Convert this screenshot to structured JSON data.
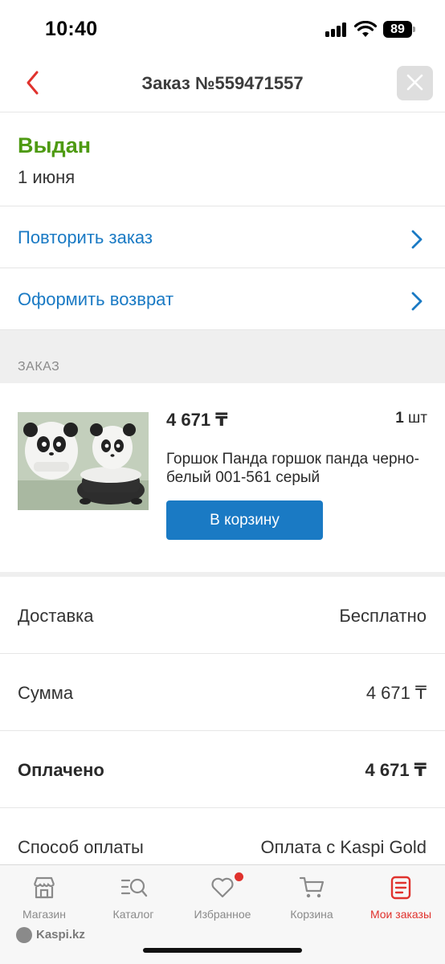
{
  "status_bar": {
    "time": "10:40",
    "battery": "89"
  },
  "header": {
    "title": "Заказ №559471557"
  },
  "order_status": {
    "title": "Выдан",
    "date": "1 июня"
  },
  "actions": [
    {
      "label": "Повторить заказ"
    },
    {
      "label": "Оформить возврат"
    }
  ],
  "section": {
    "label": "ЗАКАЗ"
  },
  "product": {
    "price": "4 671 ₸",
    "qty_number": "1",
    "qty_unit": "шт",
    "name": "Горшок Панда горшок панда черно-белый 001-561 серый",
    "cart_button": "В корзину"
  },
  "summary": [
    {
      "label": "Доставка",
      "value": "Бесплатно"
    },
    {
      "label": "Сумма",
      "value": "4 671 ₸"
    },
    {
      "label": "Оплачено",
      "value": "4 671 ₸"
    },
    {
      "label": "Способ оплаты",
      "value": "Оплата с Kaspi Gold"
    }
  ],
  "tabs": [
    {
      "label": "Магазин",
      "icon": "store-icon"
    },
    {
      "label": "Каталог",
      "icon": "catalog-search-icon"
    },
    {
      "label": "Избранное",
      "icon": "heart-icon"
    },
    {
      "label": "Корзина",
      "icon": "cart-icon"
    },
    {
      "label": "Мои заказы",
      "icon": "orders-icon"
    }
  ],
  "watermark": "Kaspi.kz",
  "colors": {
    "accent_red": "#e0322d",
    "link_blue": "#1a7ac4",
    "status_green": "#4e9a12"
  }
}
